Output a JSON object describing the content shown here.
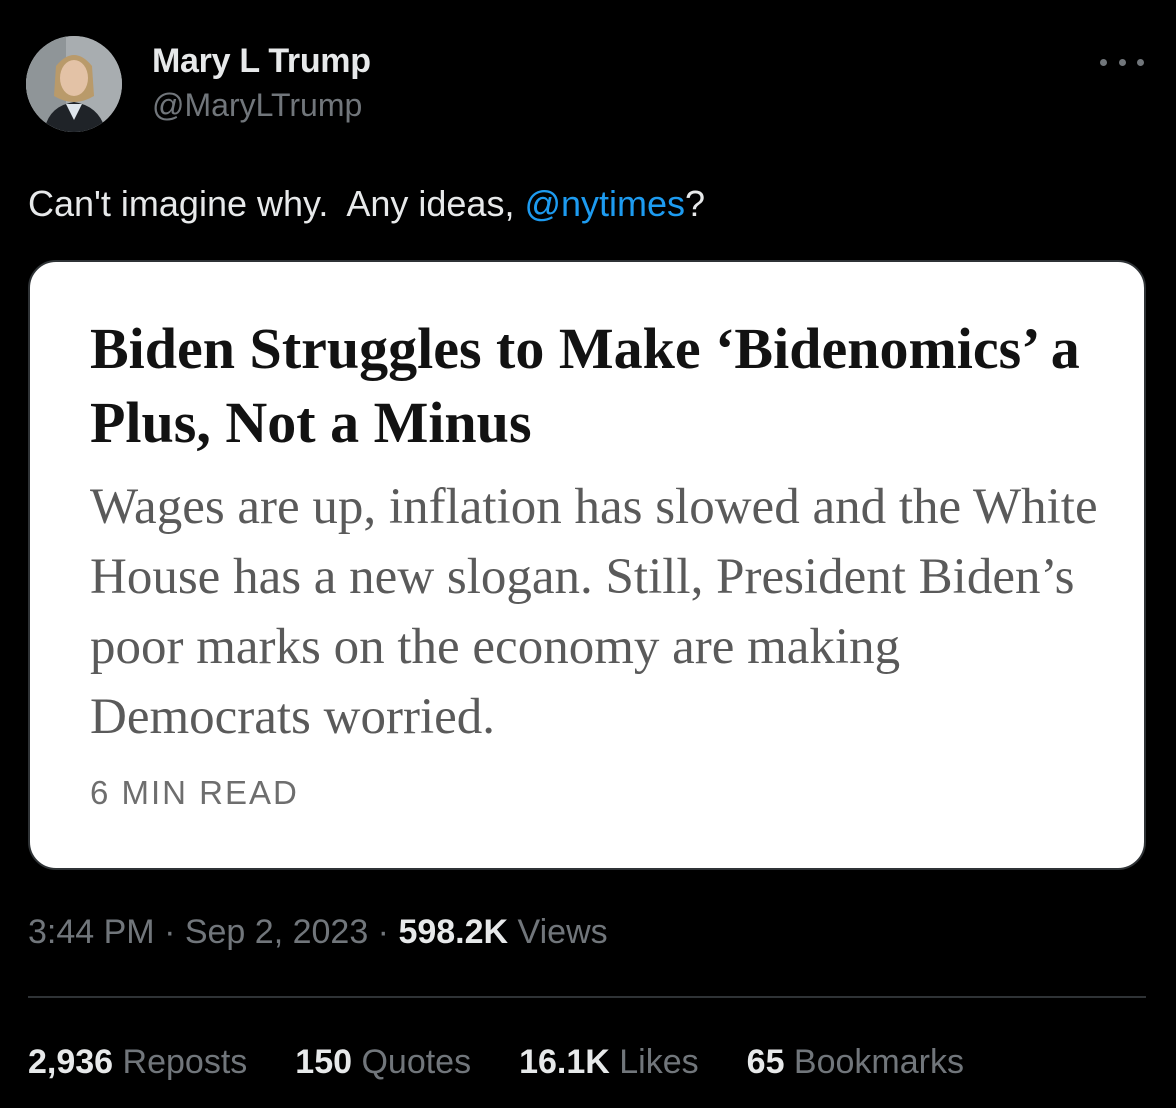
{
  "author": {
    "display_name": "Mary L Trump",
    "handle": "@MaryLTrump"
  },
  "tweet": {
    "text_before": "Can't imagine why.  Any ideas, ",
    "mention": "@nytimes",
    "text_after": "?"
  },
  "article_card": {
    "headline": "Biden Struggles to Make ‘Bidenomics’ a Plus, Not a Minus",
    "summary": "Wages are up, inflation has slowed and the White House has a new slogan. Still, President Biden’s poor marks on the economy are making Democrats worried.",
    "read_time": "6 MIN READ"
  },
  "meta": {
    "time": "3:44 PM",
    "separator": " · ",
    "date": "Sep 2, 2023",
    "views_count": "598.2K",
    "views_label": " Views"
  },
  "stats": [
    {
      "count": "2,936",
      "label": " Reposts"
    },
    {
      "count": "150",
      "label": " Quotes"
    },
    {
      "count": "16.1K",
      "label": " Likes"
    },
    {
      "count": "65",
      "label": " Bookmarks"
    }
  ],
  "colors": {
    "background": "#000000",
    "text_primary": "#e7e9ea",
    "text_secondary": "#71767b",
    "link": "#1d9bf0",
    "card_bg": "#ffffff"
  },
  "icons": {
    "more": "more-horizontal-icon"
  }
}
